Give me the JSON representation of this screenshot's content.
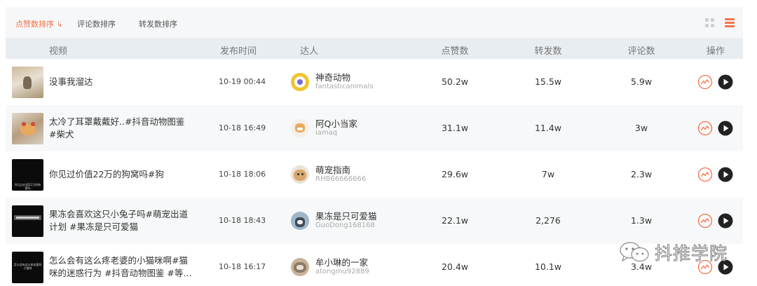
{
  "sort_tabs": [
    {
      "label": "点赞数排序",
      "active": true
    },
    {
      "label": "评论数排序",
      "active": false
    },
    {
      "label": "转发数排序",
      "active": false
    }
  ],
  "columns": {
    "video": "视频",
    "publish_time": "发布时间",
    "influencer": "达人",
    "likes": "点赞数",
    "shares": "转发数",
    "comments": "评论数",
    "actions": "操作"
  },
  "rows": [
    {
      "title": "没事我溜达",
      "time": "10-19 00:44",
      "kol_name": "神奇动物",
      "kol_id": "fantasticanimals",
      "likes": "50.2w",
      "shares": "15.5w",
      "comments": "5.9w",
      "thumb_caption": ""
    },
    {
      "title": "太冷了耳罩戴戴好..#抖音动物图鉴 #柴犬",
      "time": "10-18 16:49",
      "kol_name": "阿Q小当家",
      "kol_id": "iamaq",
      "likes": "31.1w",
      "shares": "11.4w",
      "comments": "3w",
      "thumb_caption": ""
    },
    {
      "title": "你见过价值22万的狗窝吗#狗",
      "time": "10-18 18:06",
      "kol_name": "萌宠指南",
      "kol_id": "RHB66666666",
      "likes": "29.6w",
      "shares": "7w",
      "comments": "2.3w",
      "thumb_caption": "你见过价值22万的狗窝吗"
    },
    {
      "title": "果冻会喜欢这只小兔子吗#萌宠出道计划 #果冻是只可爱猫",
      "time": "10-18 18:43",
      "kol_name": "果冻是只可爱猫",
      "kol_id": "GuoDong168168",
      "likes": "22.1w",
      "shares": "2,276",
      "comments": "1.3w",
      "thumb_caption": ""
    },
    {
      "title": "怎么会有这么疼老婆的小猫咪啊#猫咪的迷惑行为 #抖音动物图鉴 #等…",
      "time": "10-18 16:17",
      "kol_name": "牟小琳的一家",
      "kol_id": "atongmu92889",
      "likes": "20.4w",
      "shares": "10.1w",
      "comments": "3.4w",
      "thumb_caption": "怎么会有这么疼老婆的小猫咪"
    }
  ],
  "icons": {
    "sort_arrow": "sort-down-arrow-icon",
    "grid_view": "grid-view-icon",
    "list_view": "list-view-icon",
    "trend": "trend-chart-icon",
    "play": "play-icon",
    "wechat": "wechat-icon"
  },
  "colors": {
    "accent": "#f3744a",
    "header_bg": "#e8edf1",
    "toolbar_bg": "#f6f7f8",
    "play_button": "#222222"
  },
  "watermark": {
    "text": "抖推学院"
  }
}
